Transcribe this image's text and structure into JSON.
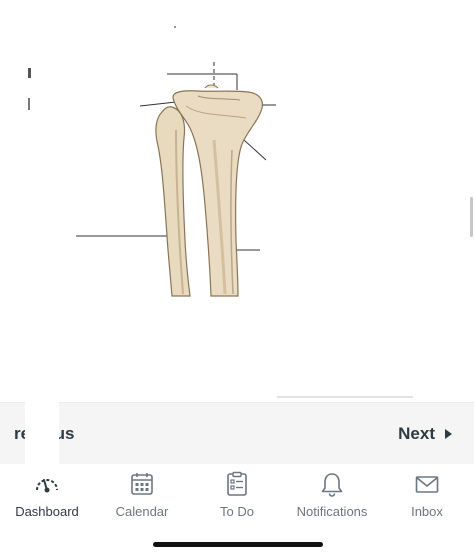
{
  "pager": {
    "previous_label": "revious",
    "next_label": "Next"
  },
  "tabs": [
    {
      "id": "dashboard",
      "label": "Dashboard",
      "icon": "dashboard-icon",
      "active": true
    },
    {
      "id": "calendar",
      "label": "Calendar",
      "icon": "calendar-icon",
      "active": false
    },
    {
      "id": "todo",
      "label": "To Do",
      "icon": "todo-icon",
      "active": false
    },
    {
      "id": "notifications",
      "label": "Notifications",
      "icon": "bell-icon",
      "active": false
    },
    {
      "id": "inbox",
      "label": "Inbox",
      "icon": "envelope-icon",
      "active": false
    }
  ],
  "colors": {
    "text": "#2d3b45",
    "tab_inactive": "#6b7780",
    "bone": "#e9dcc0",
    "bone_shadow": "#b9a27e"
  }
}
